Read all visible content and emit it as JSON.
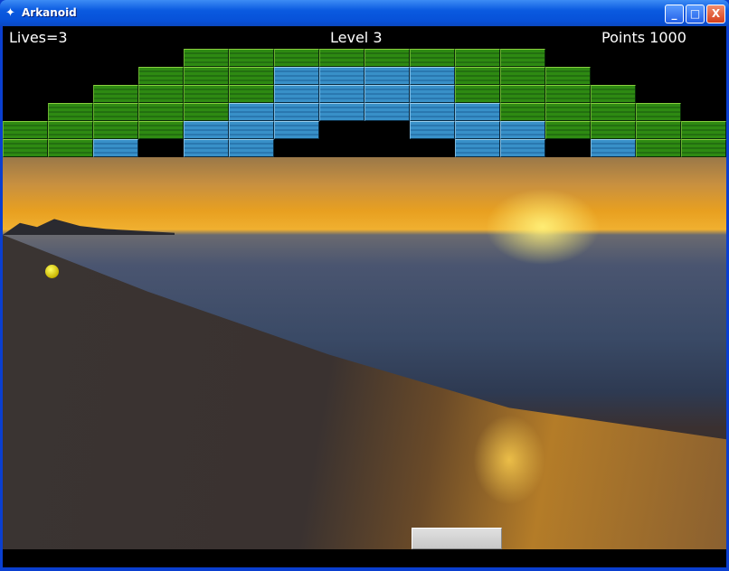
{
  "window": {
    "title": "Arkanoid",
    "minimize": "_",
    "maximize": "□",
    "close": "X"
  },
  "hud": {
    "lives": "Lives=3",
    "level": "Level 3",
    "points": "Points 1000"
  },
  "bricks": {
    "legend": {
      "G": "green",
      "B": "blue",
      ".": "empty"
    },
    "colors": {
      "G": "#2e8a12",
      "B": "#3890c8"
    },
    "rows": [
      "....GGGGGGGG....",
      "...GGGBBBBGGG...",
      "..GGGGBBBBGGGG..",
      ".GGGGBBBBBBGGGG.",
      "GGGGBBB..BBBGGGG",
      "GGB.BB....BB.BGG"
    ]
  }
}
